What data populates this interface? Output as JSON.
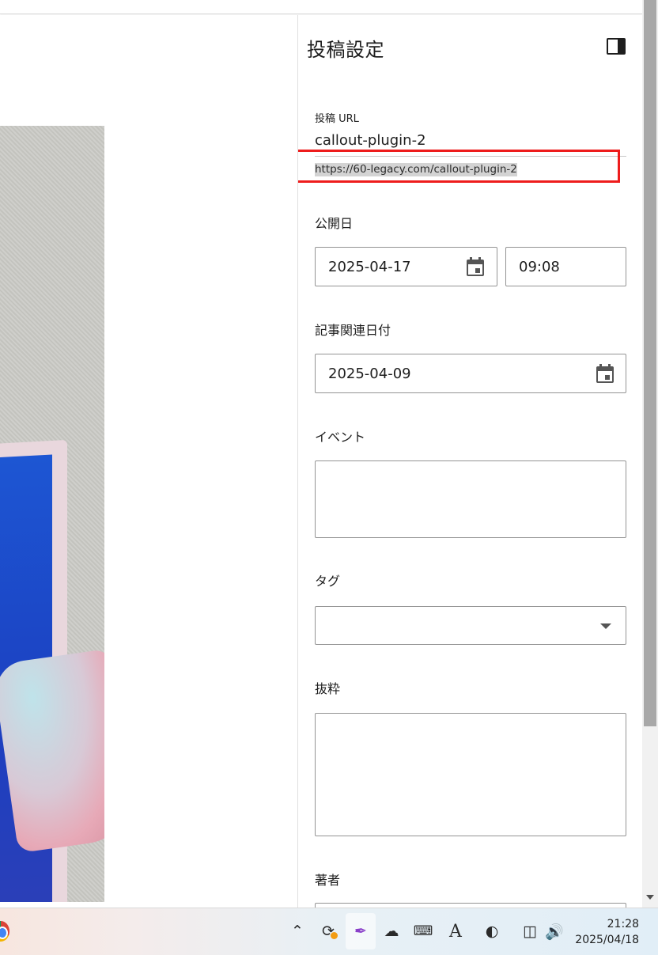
{
  "sidebar": {
    "title": "投稿設定",
    "url": {
      "label": "投稿 URL",
      "slug": "callout-plugin-2",
      "full": "https://60-legacy.com/callout-plugin-2"
    },
    "publish": {
      "label": "公開日",
      "date": "2025-04-17",
      "time": "09:08"
    },
    "related_date": {
      "label": "記事関連日付",
      "date": "2025-04-09"
    },
    "event": {
      "label": "イベント",
      "value": ""
    },
    "tag": {
      "label": "タグ",
      "value": ""
    },
    "excerpt": {
      "label": "抜粋",
      "value": ""
    },
    "author": {
      "label": "著者"
    }
  },
  "taskbar": {
    "clock_time": "21:28",
    "clock_date": "2025/04/18",
    "icons": [
      "chrome-icon",
      "chevron-up-icon",
      "sync-icon",
      "pen-icon",
      "onedrive-cloud-icon",
      "keyboard-icon",
      "ime-a-icon",
      "ime-mode-icon",
      "display-icon",
      "speaker-icon"
    ]
  },
  "colors": {
    "highlight_box": "#ee1c1c",
    "url_selection": "#d3d3d3",
    "border": "#949494"
  }
}
